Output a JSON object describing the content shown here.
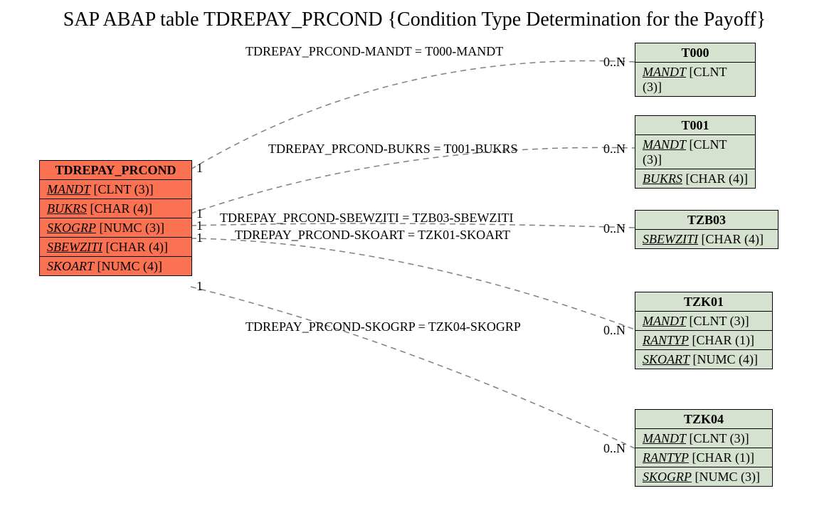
{
  "title": "SAP ABAP table TDREPAY_PRCOND {Condition Type Determination for the Payoff}",
  "main_table": {
    "name": "TDREPAY_PRCOND",
    "fields": [
      {
        "name": "MANDT",
        "type": "[CLNT (3)]",
        "key": true
      },
      {
        "name": "BUKRS",
        "type": "[CHAR (4)]",
        "key": true
      },
      {
        "name": "SKOGRP",
        "type": "[NUMC (3)]",
        "key": true
      },
      {
        "name": "SBEWZITI",
        "type": "[CHAR (4)]",
        "key": true
      },
      {
        "name": "SKOART",
        "type": "[NUMC (4)]",
        "key": false
      }
    ]
  },
  "related_tables": [
    {
      "name": "T000",
      "fields": [
        {
          "name": "MANDT",
          "type": "[CLNT (3)]",
          "key": true
        }
      ]
    },
    {
      "name": "T001",
      "fields": [
        {
          "name": "MANDT",
          "type": "[CLNT (3)]",
          "key": true
        },
        {
          "name": "BUKRS",
          "type": "[CHAR (4)]",
          "key": true
        }
      ]
    },
    {
      "name": "TZB03",
      "fields": [
        {
          "name": "SBEWZITI",
          "type": "[CHAR (4)]",
          "key": true
        }
      ]
    },
    {
      "name": "TZK01",
      "fields": [
        {
          "name": "MANDT",
          "type": "[CLNT (3)]",
          "key": true
        },
        {
          "name": "RANTYP",
          "type": "[CHAR (1)]",
          "key": true
        },
        {
          "name": "SKOART",
          "type": "[NUMC (4)]",
          "key": true
        }
      ]
    },
    {
      "name": "TZK04",
      "fields": [
        {
          "name": "MANDT",
          "type": "[CLNT (3)]",
          "key": true
        },
        {
          "name": "RANTYP",
          "type": "[CHAR (1)]",
          "key": true
        },
        {
          "name": "SKOGRP",
          "type": "[NUMC (3)]",
          "key": true
        }
      ]
    }
  ],
  "relations": [
    {
      "label": "TDREPAY_PRCOND-MANDT = T000-MANDT",
      "left_card": "1",
      "right_card": "0..N",
      "rel_idx": 0
    },
    {
      "label": "TDREPAY_PRCOND-BUKRS = T001-BUKRS",
      "left_card": "1",
      "right_card": "0..N",
      "rel_idx": 1
    },
    {
      "label": "TDREPAY_PRCOND-SBEWZITI = TZB03-SBEWZITI",
      "left_card": "1",
      "right_card": "0..N",
      "rel_idx": 2
    },
    {
      "label": "TDREPAY_PRCOND-SKOART = TZK01-SKOART",
      "left_card": "1",
      "right_card": "0..N",
      "rel_idx": 3
    },
    {
      "label": "TDREPAY_PRCOND-SKOGRP = TZK04-SKOGRP",
      "left_card": "1",
      "right_card": "0..N",
      "rel_idx": 4
    }
  ],
  "colors": {
    "main_bg": "#fb7253",
    "rel_bg": "#d5e2cf",
    "line": "#808080"
  }
}
